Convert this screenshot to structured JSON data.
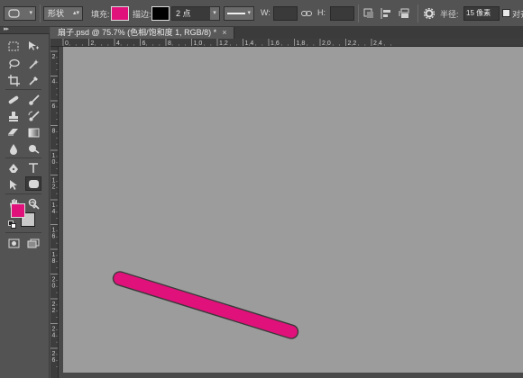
{
  "options_bar": {
    "mode_label": "形状",
    "fill_label": "填充:",
    "fill_color": "#e0117a",
    "stroke_label": "描边:",
    "stroke_color": "#000000",
    "stroke_width": "2 点",
    "width_label": "W:",
    "height_label": "H:",
    "radius_label": "半径:",
    "radius_value": "15 像素",
    "align_edges_label": "对齐边缘"
  },
  "document": {
    "tab_title": "扇子.psd @ 75.7% (色相/饱和度 1, RGB/8) *",
    "close_label": "×",
    "canvas_color": "#9c9c9c",
    "shape": {
      "type": "rounded-rectangle",
      "fill": "#e0117a",
      "stroke": "#3a3a3a"
    }
  },
  "rulers": {
    "horizontal_labels": [
      "0",
      "2",
      "4",
      "6",
      "8",
      "1 0",
      "1 2",
      "1 4",
      "1 6",
      "1 8",
      "2 0",
      "2 2",
      "2 4"
    ],
    "vertical_labels": [
      "2",
      "4",
      "6",
      "8",
      "1 0",
      "1 2",
      "1 4",
      "1 6",
      "1 8",
      "2 0",
      "2 2",
      "2 4",
      "2 6"
    ]
  },
  "toolbox": {
    "foreground_color": "#e0117a",
    "background_color": "#c9c9c9",
    "tools": [
      "rect-marquee",
      "move",
      "lasso",
      "magic-wand",
      "crop",
      "eyedropper",
      "healing",
      "brush",
      "clone-stamp",
      "history-brush",
      "eraser",
      "gradient",
      "blur",
      "dodge",
      "pen",
      "type",
      "path-select",
      "rounded-rect",
      "hand",
      "zoom"
    ]
  }
}
